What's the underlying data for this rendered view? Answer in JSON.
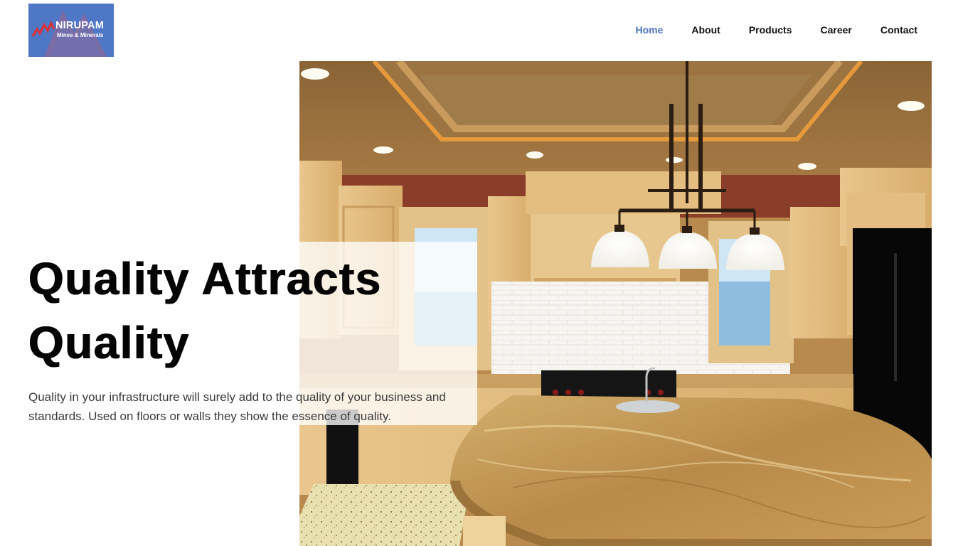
{
  "brand": {
    "name": "NIRUPAM",
    "tagline": "Mines & Minerals",
    "logo_color": "#4e77c6"
  },
  "nav": {
    "items": [
      {
        "label": "Home",
        "active": true
      },
      {
        "label": "About",
        "active": false
      },
      {
        "label": "Products",
        "active": false
      },
      {
        "label": "Career",
        "active": false
      },
      {
        "label": "Contact",
        "active": false
      }
    ],
    "active_color": "#4b73c4"
  },
  "hero": {
    "title_line1": "Quality Attracts",
    "title_line2": "Quality",
    "text": "Quality in your infrastructure will surely add to the quality of your business and standards. Used on floors or walls they show the essence of quality.",
    "image": "kitchen interior with granite countertop"
  }
}
